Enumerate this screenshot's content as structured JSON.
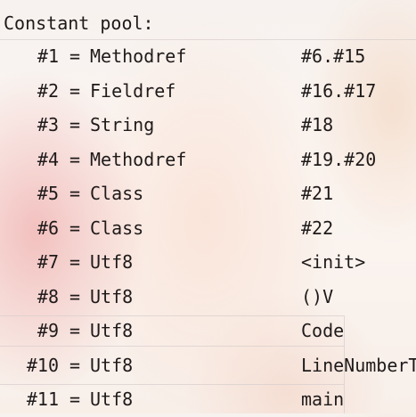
{
  "header": {
    "title": "Constant pool:"
  },
  "entries": [
    {
      "index": "#1",
      "type": "Methodref",
      "value": "#6.#15"
    },
    {
      "index": "#2",
      "type": "Fieldref",
      "value": "#16.#17"
    },
    {
      "index": "#3",
      "type": "String",
      "value": "#18"
    },
    {
      "index": "#4",
      "type": "Methodref",
      "value": "#19.#20"
    },
    {
      "index": "#5",
      "type": "Class",
      "value": "#21"
    },
    {
      "index": "#6",
      "type": "Class",
      "value": "#22"
    },
    {
      "index": "#7",
      "type": "Utf8",
      "value": "<init>"
    },
    {
      "index": "#8",
      "type": "Utf8",
      "value": "()V"
    },
    {
      "index": "#9",
      "type": "Utf8",
      "value": "Code"
    },
    {
      "index": "#10",
      "type": "Utf8",
      "value": "LineNumberT"
    },
    {
      "index": "#11",
      "type": "Utf8",
      "value": "main"
    }
  ],
  "equals_sign": "="
}
